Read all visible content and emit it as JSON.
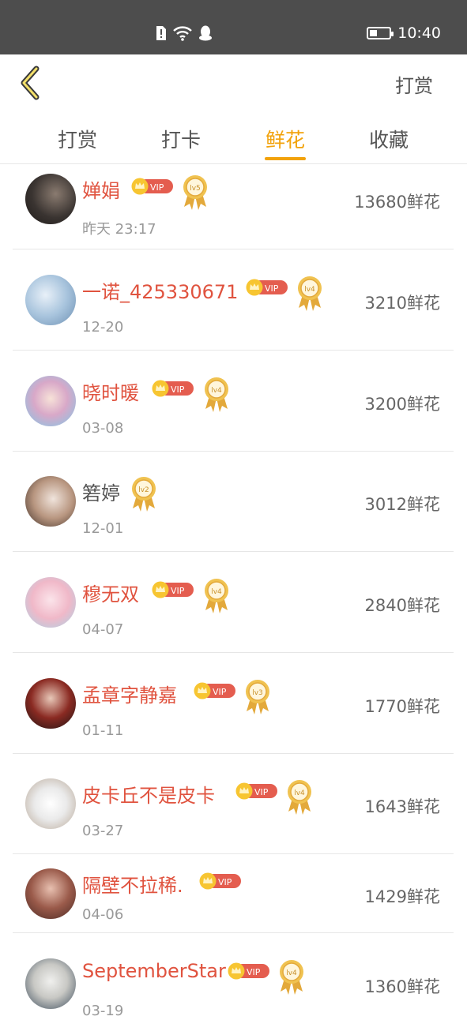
{
  "status_bar": {
    "time": "10:40",
    "icons": [
      "sim-alert-icon",
      "wifi-icon",
      "qq-icon"
    ],
    "battery": "battery-icon"
  },
  "nav": {
    "back_icon": "chevron-left-icon",
    "action_label": "打赏"
  },
  "tabs": [
    {
      "label": "打赏",
      "active": false
    },
    {
      "label": "打卡",
      "active": false
    },
    {
      "label": "鲜花",
      "active": true
    },
    {
      "label": "收藏",
      "active": false
    }
  ],
  "colors": {
    "accent": "#f2a20a",
    "vip_name": "#e0533f",
    "text_gray": "#555555",
    "meta_gray": "#999999"
  },
  "list": [
    {
      "name": "婵娟",
      "vip": true,
      "level": "lv5",
      "date": "昨天 23:17",
      "amount": "13680鲜花"
    },
    {
      "name": "一诺_425330671",
      "vip": true,
      "level": "lv4",
      "date": "12-20",
      "amount": "3210鲜花"
    },
    {
      "name": "晓时暖",
      "vip": true,
      "level": "lv4",
      "date": "03-08",
      "amount": "3200鲜花"
    },
    {
      "name": "箬婷",
      "vip": false,
      "level": "lv2",
      "date": "12-01",
      "amount": "3012鲜花"
    },
    {
      "name": "穆无双",
      "vip": true,
      "level": "lv4",
      "date": "04-07",
      "amount": "2840鲜花"
    },
    {
      "name": "孟章字静嘉",
      "vip": true,
      "level": "lv3",
      "date": "01-11",
      "amount": "1770鲜花"
    },
    {
      "name": "皮卡丘不是皮卡",
      "vip": true,
      "level": "lv4",
      "date": "03-27",
      "amount": "1643鲜花"
    },
    {
      "name": "隔壁不拉稀.",
      "vip": true,
      "level": "",
      "date": "04-06",
      "amount": "1429鲜花"
    },
    {
      "name": "SeptemberStar",
      "vip": true,
      "level": "lv4",
      "date": "03-19",
      "amount": "1360鲜花"
    }
  ],
  "vip_label": "VIP"
}
